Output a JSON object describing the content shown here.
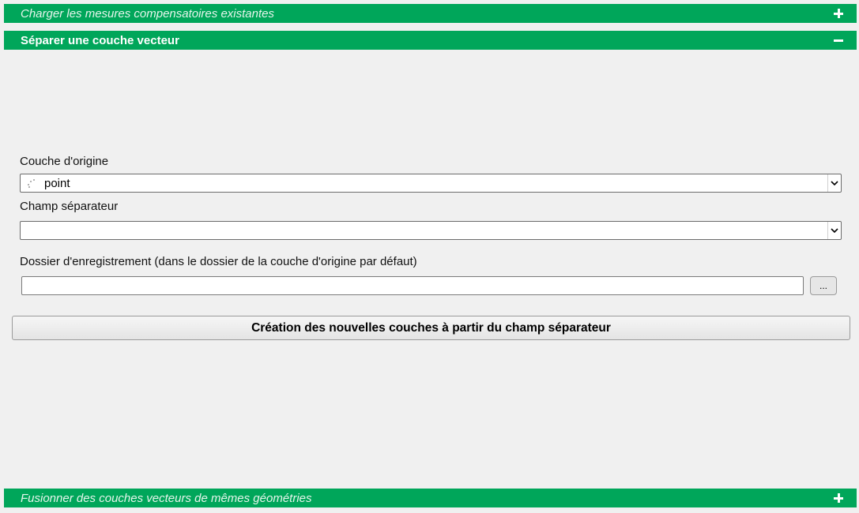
{
  "sections": {
    "charger": {
      "title": "Charger les mesures compensatoires existantes",
      "toggle_icon": "plus-icon"
    },
    "separer": {
      "title": "Séparer une couche vecteur",
      "toggle_icon": "minus-icon"
    },
    "fusionner": {
      "title": "Fusionner des couches vecteurs de mêmes géométries",
      "toggle_icon": "plus-icon"
    }
  },
  "form": {
    "couche_label": "Couche d'origine",
    "couche_value": "point",
    "couche_icon": "point-layer-icon",
    "champ_label": "Champ séparateur",
    "champ_value": "",
    "dossier_label": "Dossier d'enregistrement (dans le dossier de la couche d'origine par défaut)",
    "dossier_value": "",
    "browse_label": "...",
    "create_button_label": "Création des nouvelles couches à partir du champ séparateur"
  },
  "colors": {
    "header_green": "#00a65a",
    "background": "#f0f0f0"
  }
}
